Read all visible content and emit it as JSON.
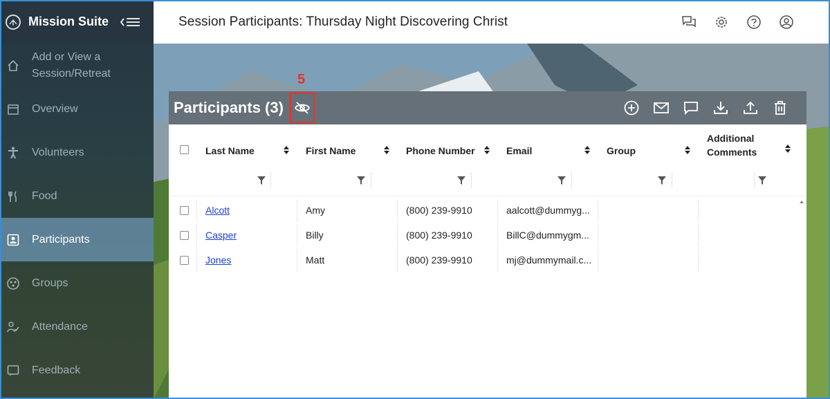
{
  "app": {
    "name": "Mission Suite"
  },
  "sidebar": {
    "items": [
      {
        "label": "Add or View a Session/Retreat",
        "icon": "home-icon",
        "active": false
      },
      {
        "label": "Overview",
        "icon": "calendar-icon",
        "active": false
      },
      {
        "label": "Volunteers",
        "icon": "person-icon",
        "active": false
      },
      {
        "label": "Food",
        "icon": "fork-knife-icon",
        "active": false
      },
      {
        "label": "Participants",
        "icon": "id-badge-icon",
        "active": true
      },
      {
        "label": "Groups",
        "icon": "groups-icon",
        "active": false
      },
      {
        "label": "Attendance",
        "icon": "person-check-icon",
        "active": false
      },
      {
        "label": "Feedback",
        "icon": "feedback-icon",
        "active": false
      }
    ]
  },
  "header": {
    "title": "Session Participants: Thursday Night Discovering Christ",
    "icons": [
      "chat-icon",
      "gear-icon",
      "help-icon",
      "account-icon"
    ]
  },
  "panel": {
    "title": "Participants (3)",
    "callout": "5",
    "actions": [
      "add-circle-icon",
      "email-icon",
      "message-icon",
      "download-icon",
      "upload-icon",
      "trash-icon"
    ]
  },
  "table": {
    "columns": [
      "Last Name",
      "First Name",
      "Phone Number",
      "Email",
      "Group",
      "Additional Comments"
    ],
    "rows": [
      {
        "last": "Alcott",
        "first": "Amy",
        "phone": "(800) 239-9910",
        "email": "aalcott@dummyg...",
        "group": "",
        "comments": ""
      },
      {
        "last": "Casper",
        "first": "Billy",
        "phone": "(800) 239-9910",
        "email": "BillC@dummygm...",
        "group": "",
        "comments": ""
      },
      {
        "last": "Jones",
        "first": "Matt",
        "phone": "(800) 239-9910",
        "email": "mj@dummymail.c...",
        "group": "",
        "comments": ""
      }
    ]
  },
  "colors": {
    "accent_sidebar_active": "#6e96b4",
    "callout": "#e5332a",
    "link": "#1a3fd0",
    "frame": "#3a8fd6"
  }
}
